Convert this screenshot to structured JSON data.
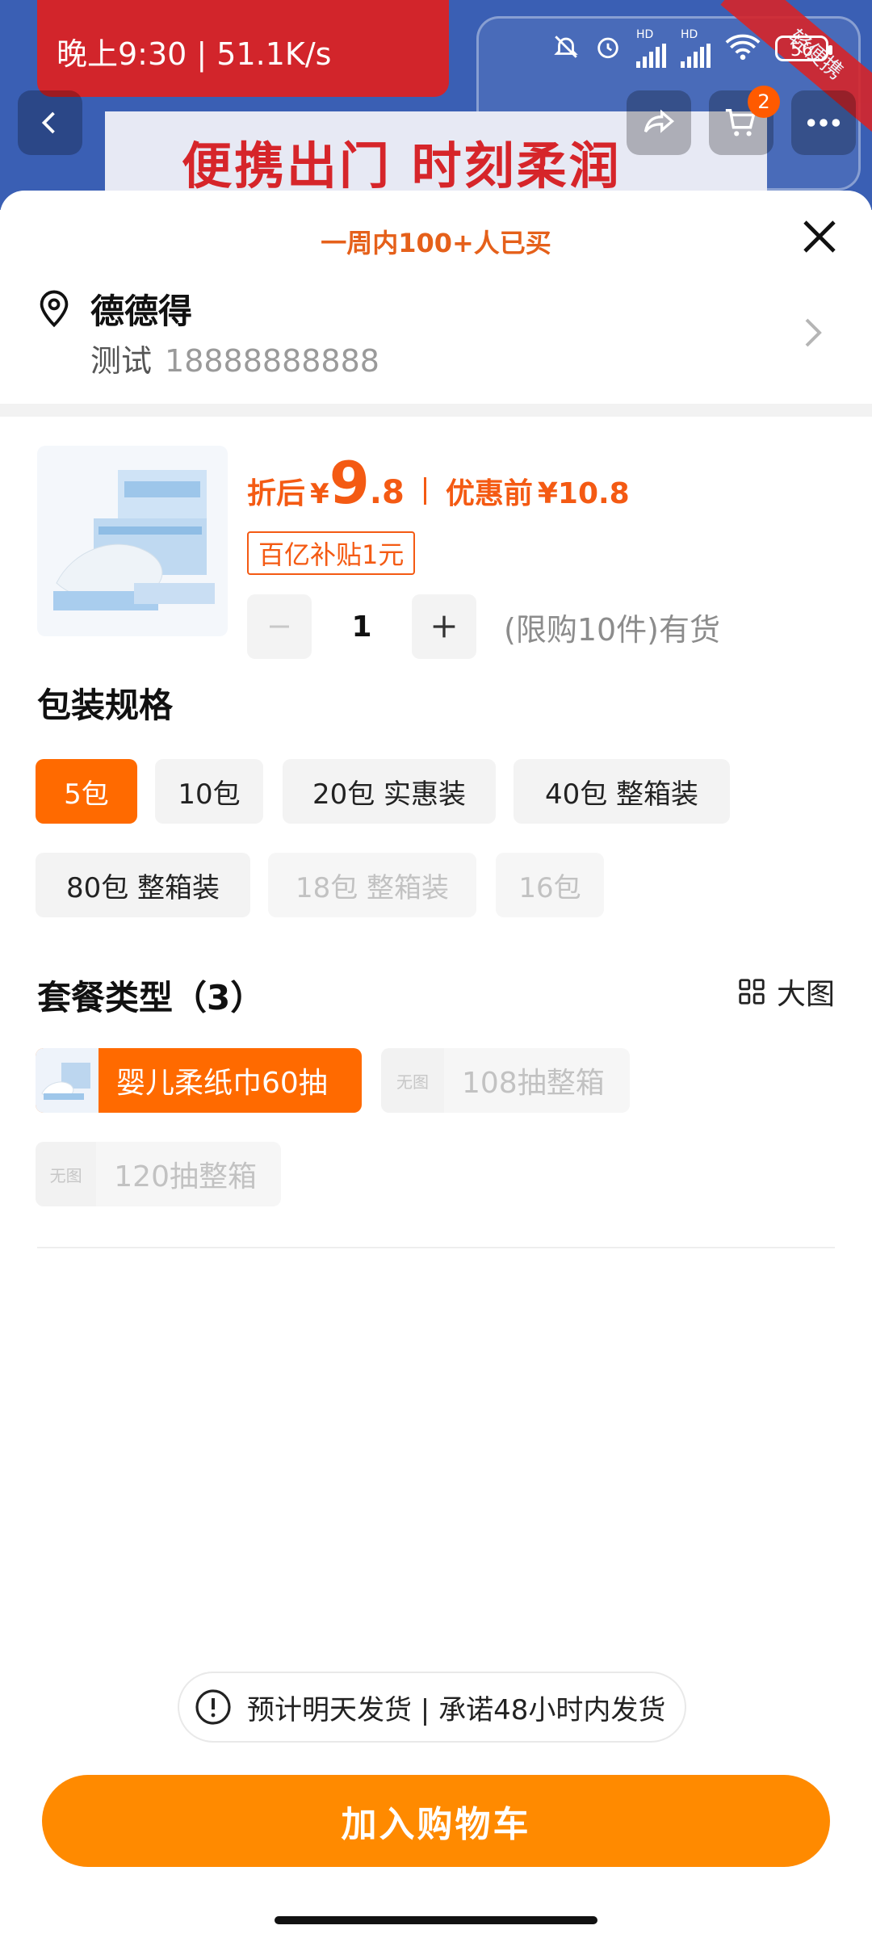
{
  "status_bar": {
    "time": "晚上9:30 | 51.1K/s",
    "signal_1": "HD",
    "signal_2": "HD",
    "battery": "56"
  },
  "background_banner": {
    "headline": "便携出门 时刻柔润",
    "corner_text": "轻便携"
  },
  "top_actions": {
    "cart_badge": "2"
  },
  "sheet": {
    "bought_label": "一周内100+人已买"
  },
  "address": {
    "name": "德德得",
    "contact": "测试",
    "phone": "18888888888"
  },
  "product": {
    "price_label": "折后",
    "currency": "¥",
    "price_int": "9",
    "price_dec": ".8",
    "before_label": "优惠前",
    "before_price": "¥10.8",
    "subsidy": "百亿补贴1元",
    "quantity": "1",
    "limit_text": "(限购10件)有货"
  },
  "spec": {
    "title": "包装规格",
    "options": [
      "5包",
      "10包",
      "20包 实惠装",
      "40包 整箱装",
      "80包 整箱装",
      "18包 整箱装",
      "16包"
    ],
    "selected": "5包"
  },
  "package": {
    "title": "套餐类型（3）",
    "big_image_label": "大图",
    "no_image": "无图",
    "options": [
      "婴儿柔纸巾60抽",
      "108抽整箱",
      "120抽整箱"
    ]
  },
  "shipping": {
    "text": "预计明天发货 | 承诺48小时内发货"
  },
  "cta": {
    "label": "加入购物车"
  },
  "colors": {
    "accent": "#ff6a00",
    "price": "#f45a13",
    "cta": "#ff8a00"
  }
}
